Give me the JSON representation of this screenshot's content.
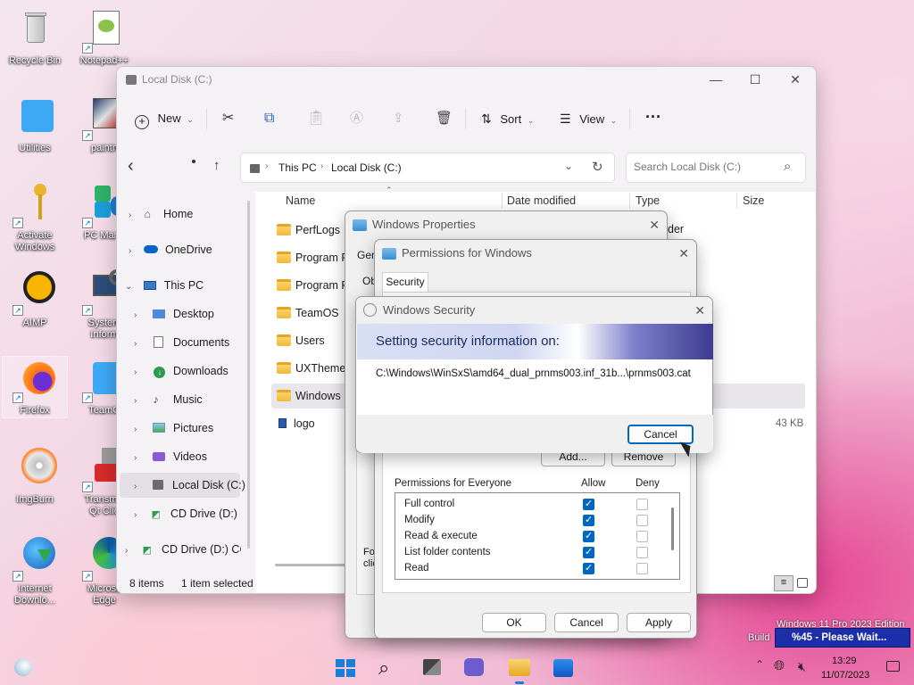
{
  "desktop": {
    "icons": [
      {
        "name": "recycle-bin",
        "label": "Recycle Bin"
      },
      {
        "name": "notepad",
        "label": "Notepad++"
      },
      {
        "name": "utilities",
        "label": "Utilities"
      },
      {
        "name": "paint",
        "label": "paintn"
      },
      {
        "name": "activate",
        "label": "Activate\nWindows"
      },
      {
        "name": "pc-manager",
        "label": "PC Mana"
      },
      {
        "name": "aimp",
        "label": "AIMP"
      },
      {
        "name": "system-info",
        "label": "System\nInform"
      },
      {
        "name": "firefox",
        "label": "Firefox"
      },
      {
        "name": "teamos",
        "label": "TeamO"
      },
      {
        "name": "imgburn",
        "label": "ImgBurn"
      },
      {
        "name": "transmission",
        "label": "Transmis\nQt Clie"
      },
      {
        "name": "idm",
        "label": "Internet\nDownlo..."
      },
      {
        "name": "edge",
        "label": "Microso\nEdge"
      }
    ]
  },
  "explorer": {
    "title": "Local Disk (C:)",
    "toolbar": {
      "new": "New",
      "sort": "Sort",
      "view": "View",
      "more": "···"
    },
    "breadcrumb": [
      "This PC",
      "Local Disk (C:)"
    ],
    "search_placeholder": "Search Local Disk (C:)",
    "columns": {
      "name": "Name",
      "date": "Date modified",
      "type": "Type",
      "size": "Size"
    },
    "sidebar": [
      {
        "label": "Home",
        "icon": "home"
      },
      {
        "label": "OneDrive",
        "icon": "cloud"
      },
      {
        "label": "This PC",
        "icon": "pc"
      },
      {
        "label": "Desktop",
        "icon": "desktop"
      },
      {
        "label": "Documents",
        "icon": "documents"
      },
      {
        "label": "Downloads",
        "icon": "downloads"
      },
      {
        "label": "Music",
        "icon": "music"
      },
      {
        "label": "Pictures",
        "icon": "pictures"
      },
      {
        "label": "Videos",
        "icon": "videos"
      },
      {
        "label": "Local Disk (C:)",
        "icon": "disk"
      },
      {
        "label": "CD Drive (D:) C(",
        "icon": "cd"
      },
      {
        "label": "CD Drive (D:) CCC",
        "icon": "cd"
      }
    ],
    "files": [
      {
        "name": "PerfLogs",
        "type_partial": ""
      },
      {
        "name": "Program Fil",
        "type_partial": ""
      },
      {
        "name": "Program Fil",
        "type_partial": ""
      },
      {
        "name": "TeamOS",
        "type_partial": ""
      },
      {
        "name": "Users",
        "type_partial": ""
      },
      {
        "name": "UXThemeP",
        "type_partial": ""
      },
      {
        "name": "Windows",
        "type_partial": ""
      },
      {
        "name": "logo",
        "size": "43 KB"
      }
    ],
    "type_fragment": "der",
    "status": {
      "items": "8 items",
      "selected": "1 item selected"
    }
  },
  "props": {
    "title": "Windows Properties",
    "tab_gen": "Gen",
    "tab_ob": "Ob",
    "fo": "Fo",
    "cli": "clic"
  },
  "perms": {
    "title": "Permissions for Windows",
    "tab": "Security",
    "add": "Add...",
    "remove": "Remove",
    "header": "Permissions for Everyone",
    "allow": "Allow",
    "deny": "Deny",
    "rows": [
      {
        "label": "Full control",
        "allow": true
      },
      {
        "label": "Modify",
        "allow": true
      },
      {
        "label": "Read & execute",
        "allow": true
      },
      {
        "label": "List folder contents",
        "allow": true
      },
      {
        "label": "Read",
        "allow": true
      }
    ],
    "ok": "OK",
    "cancel": "Cancel",
    "apply": "Apply"
  },
  "security": {
    "title": "Windows Security",
    "heading": "Setting security information on:",
    "path": "C:\\Windows\\WinSxS\\amd64_dual_prnms003.inf_31b...\\prnms003.cat",
    "cancel": "Cancel"
  },
  "overlay": {
    "edition": "Windows 11 Pro 2023 Edition",
    "build": "Build",
    "progress_text": "%45 - Please Wait..."
  },
  "taskbar": {
    "time": "13:29",
    "date": "11/07/2023"
  }
}
